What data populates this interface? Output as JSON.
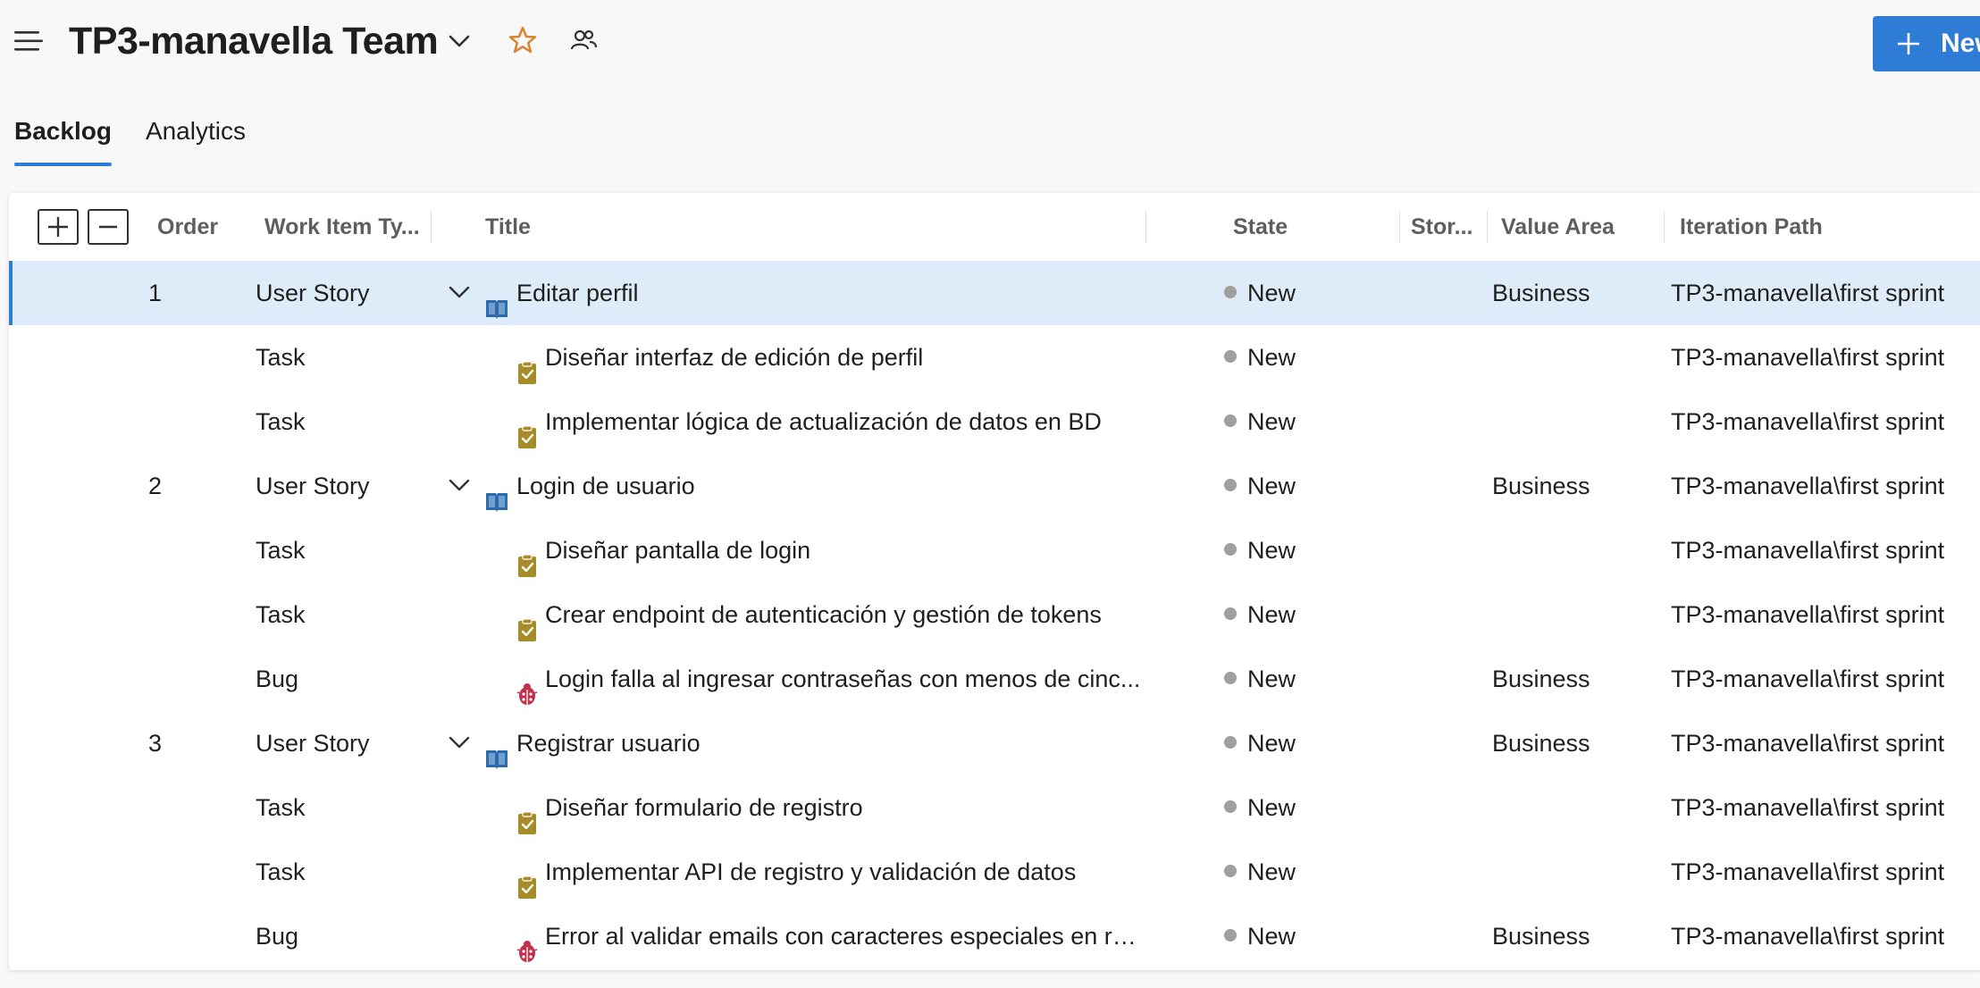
{
  "header": {
    "team_name": "TP3-manavella Team",
    "new_button_label": "New"
  },
  "tabs": [
    {
      "label": "Backlog",
      "active": true
    },
    {
      "label": "Analytics",
      "active": false
    }
  ],
  "columns": {
    "order": "Order",
    "work_item_type": "Work Item Ty...",
    "title": "Title",
    "state": "State",
    "story_points": "Stor...",
    "value_area": "Value Area",
    "iteration_path": "Iteration Path"
  },
  "colors": {
    "accent": "#2e7cd6",
    "selected_row": "#deecf9",
    "user_story_icon": "#2b6cb0",
    "task_icon": "#a88b29",
    "bug_icon": "#c4314b",
    "state_new_dot": "#a19f9d"
  },
  "rows": [
    {
      "order": "1",
      "type": "User Story",
      "icon": "book-icon",
      "title": "Editar perfil",
      "state": "New",
      "value_area": "Business",
      "iteration": "TP3-manavella\\first sprint",
      "level": 0,
      "expanded": true,
      "selected": true
    },
    {
      "order": "",
      "type": "Task",
      "icon": "clipboard-check-icon",
      "title": "Diseñar interfaz de edición de perfil",
      "state": "New",
      "value_area": "",
      "iteration": "TP3-manavella\\first sprint",
      "level": 1
    },
    {
      "order": "",
      "type": "Task",
      "icon": "clipboard-check-icon",
      "title": "Implementar lógica de actualización de datos en BD",
      "state": "New",
      "value_area": "",
      "iteration": "TP3-manavella\\first sprint",
      "level": 1
    },
    {
      "order": "2",
      "type": "User Story",
      "icon": "book-icon",
      "title": "Login de usuario",
      "state": "New",
      "value_area": "Business",
      "iteration": "TP3-manavella\\first sprint",
      "level": 0,
      "expanded": true
    },
    {
      "order": "",
      "type": "Task",
      "icon": "clipboard-check-icon",
      "title": "Diseñar pantalla de login",
      "state": "New",
      "value_area": "",
      "iteration": "TP3-manavella\\first sprint",
      "level": 1
    },
    {
      "order": "",
      "type": "Task",
      "icon": "clipboard-check-icon",
      "title": "Crear endpoint de autenticación y gestión de tokens",
      "state": "New",
      "value_area": "",
      "iteration": "TP3-manavella\\first sprint",
      "level": 1
    },
    {
      "order": "",
      "type": "Bug",
      "icon": "bug-icon",
      "title": "Login falla al ingresar contraseñas con menos de cinc...",
      "state": "New",
      "value_area": "Business",
      "iteration": "TP3-manavella\\first sprint",
      "level": 1
    },
    {
      "order": "3",
      "type": "User Story",
      "icon": "book-icon",
      "title": "Registrar usuario",
      "state": "New",
      "value_area": "Business",
      "iteration": "TP3-manavella\\first sprint",
      "level": 0,
      "expanded": true
    },
    {
      "order": "",
      "type": "Task",
      "icon": "clipboard-check-icon",
      "title": "Diseñar formulario de registro",
      "state": "New",
      "value_area": "",
      "iteration": "TP3-manavella\\first sprint",
      "level": 1
    },
    {
      "order": "",
      "type": "Task",
      "icon": "clipboard-check-icon",
      "title": "Implementar API de registro y validación de datos",
      "state": "New",
      "value_area": "",
      "iteration": "TP3-manavella\\first sprint",
      "level": 1
    },
    {
      "order": "",
      "type": "Bug",
      "icon": "bug-icon",
      "title": "Error al validar emails con caracteres especiales en re...",
      "state": "New",
      "value_area": "Business",
      "iteration": "TP3-manavella\\first sprint",
      "level": 1
    }
  ]
}
